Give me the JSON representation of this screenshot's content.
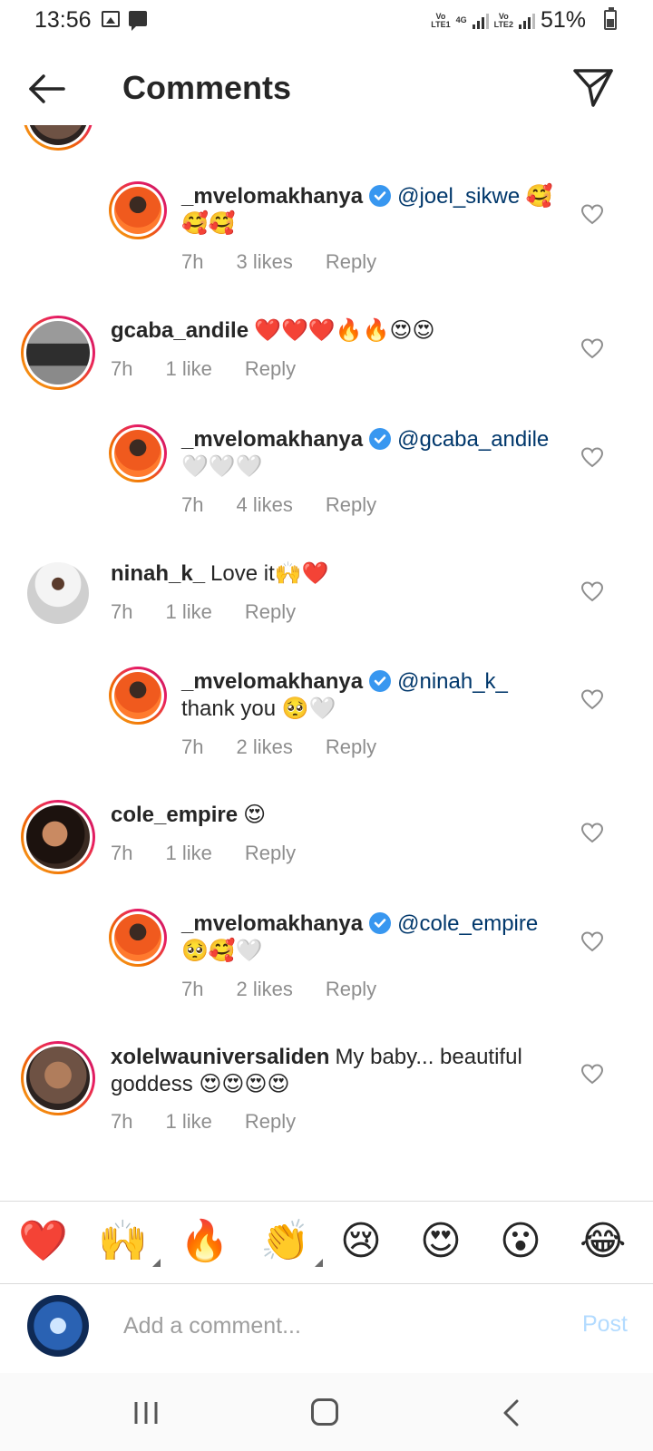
{
  "status_bar": {
    "time": "13:56",
    "sim1_label": "Vo\nLTE1",
    "network": "4G",
    "sim2_label": "Vo\nLTE2",
    "battery": "51%"
  },
  "header": {
    "title": "Comments",
    "back_icon": "arrow-left-icon",
    "send_icon": "paper-plane-icon"
  },
  "comments": [
    {
      "user": "_mvelomakhanya",
      "verified": true,
      "mention": "@joel_sikwe",
      "text": "🥰🥰🥰",
      "time": "7h",
      "likes": "3 likes",
      "reply": "Reply"
    },
    {
      "user": "gcaba_andile",
      "verified": false,
      "mention": "",
      "text": "❤️❤️❤️🔥🔥😍😍",
      "time": "7h",
      "likes": "1 like",
      "reply": "Reply"
    },
    {
      "user": "_mvelomakhanya",
      "verified": true,
      "mention": "@gcaba_andile",
      "text": "🤍🤍🤍",
      "time": "7h",
      "likes": "4 likes",
      "reply": "Reply"
    },
    {
      "user": "ninah_k_",
      "verified": false,
      "mention": "",
      "text": "Love it🙌❤️",
      "time": "7h",
      "likes": "1 like",
      "reply": "Reply"
    },
    {
      "user": "_mvelomakhanya",
      "verified": true,
      "mention": "@ninah_k_",
      "text": "thank you 🥺🤍",
      "time": "7h",
      "likes": "2 likes",
      "reply": "Reply"
    },
    {
      "user": "cole_empire",
      "verified": false,
      "mention": "",
      "text": "😍",
      "time": "7h",
      "likes": "1 like",
      "reply": "Reply"
    },
    {
      "user": "_mvelomakhanya",
      "verified": true,
      "mention": "@cole_empire",
      "text": "🥺🥰🤍",
      "time": "7h",
      "likes": "2 likes",
      "reply": "Reply"
    },
    {
      "user": "xolelwauniversaliden",
      "verified": false,
      "mention": "",
      "text": "My baby... beautiful goddess 😍😍😍😍",
      "time": "7h",
      "likes": "1 like",
      "reply": "Reply"
    }
  ],
  "reactions": [
    "❤️",
    "🙌",
    "🔥",
    "👏",
    "😢",
    "😍",
    "😮",
    "😂"
  ],
  "compose": {
    "placeholder": "Add a comment...",
    "post_label": "Post"
  },
  "colors": {
    "mention": "#00376b",
    "verified": "#3897f0",
    "post_disabled": "#b3dbff",
    "meta_text": "#8e8e8e"
  }
}
